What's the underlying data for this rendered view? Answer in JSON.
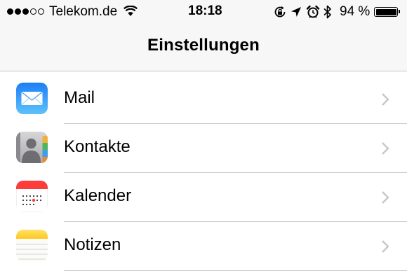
{
  "status_bar": {
    "carrier": "Telekom.de",
    "signal_bars_filled": 3,
    "signal_bars_total": 5,
    "time": "18:18",
    "battery_percent": "94 %",
    "icons": [
      "wifi-icon",
      "rotation-lock-icon",
      "location-arrow-icon",
      "alarm-icon",
      "bluetooth-icon",
      "battery-icon"
    ]
  },
  "nav": {
    "title": "Einstellungen"
  },
  "settings_items": [
    {
      "label": "Mail",
      "icon": "mail-icon",
      "color": "#1c8ef9"
    },
    {
      "label": "Kontakte",
      "icon": "contacts-icon",
      "color": "#b5b5b8"
    },
    {
      "label": "Kalender",
      "icon": "calendar-icon",
      "color": "#fc3d39"
    },
    {
      "label": "Notizen",
      "icon": "notes-icon",
      "color": "#ffd426"
    }
  ]
}
